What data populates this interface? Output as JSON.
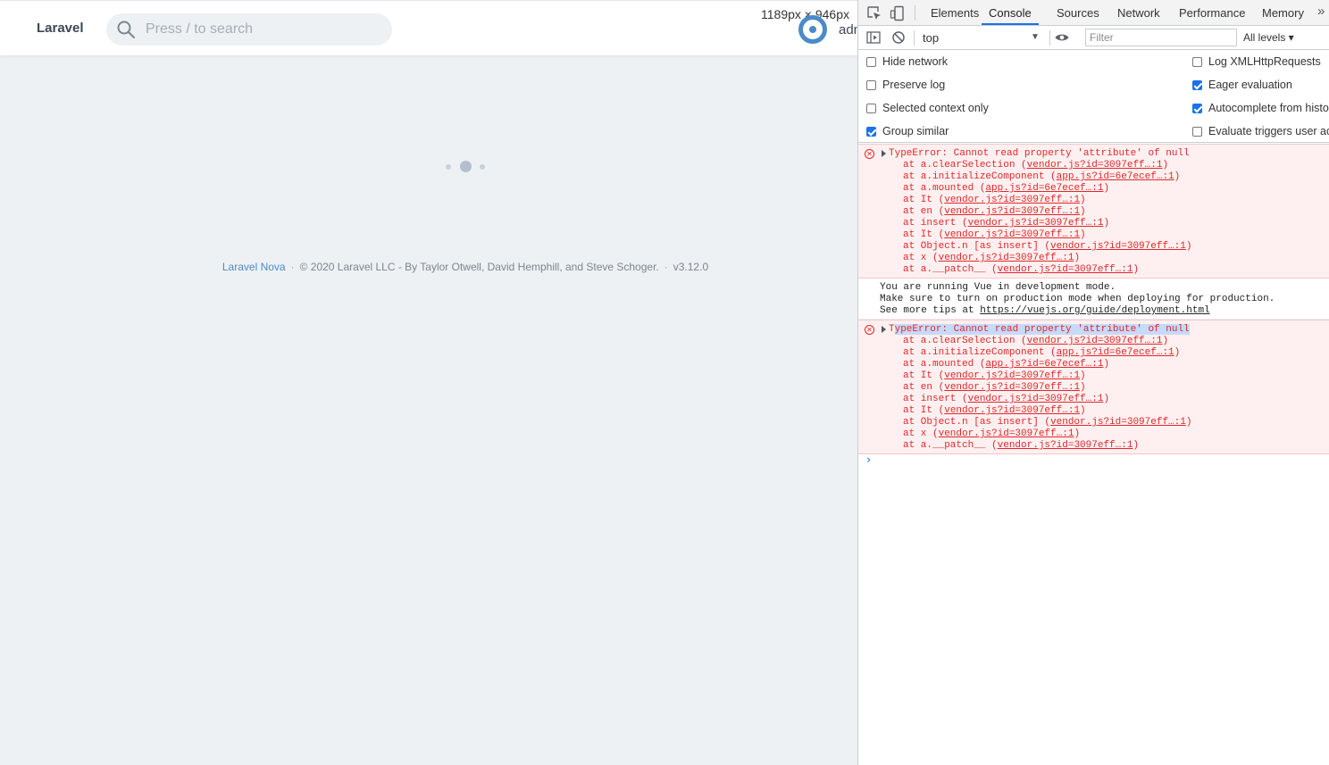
{
  "app": {
    "brand": "Laravel",
    "search_placeholder": "Press / to search",
    "dimensions_tip": "1189px × 946px",
    "user_name": "admin",
    "footer": {
      "link": "Laravel Nova",
      "copyright": "© 2020 Laravel LLC - By Taylor Otwell, David Hemphill, and Steve Schoger.",
      "version": "v3.12.0"
    }
  },
  "devtools": {
    "tabs": [
      "Elements",
      "Console",
      "Sources",
      "Network",
      "Performance",
      "Memory"
    ],
    "active_tab": "Console",
    "more": "»",
    "context": "top",
    "filter_placeholder": "Filter",
    "levels": "All levels ▾",
    "settings": {
      "hide_network": {
        "label": "Hide network",
        "checked": false
      },
      "preserve_log": {
        "label": "Preserve log",
        "checked": false
      },
      "selected_context": {
        "label": "Selected context only",
        "checked": false
      },
      "group_similar": {
        "label": "Group similar",
        "checked": true
      },
      "log_xhr": {
        "label": "Log XMLHttpRequests",
        "checked": false
      },
      "eager_eval": {
        "label": "Eager evaluation",
        "checked": true
      },
      "autocomplete": {
        "label": "Autocomplete from history",
        "checked": true
      },
      "eval_triggers": {
        "label": "Evaluate triggers user activation",
        "checked": false
      }
    },
    "console": {
      "error_head": "TypeError: Cannot read property 'attribute' of null",
      "frames": [
        {
          "fn": "at a.clearSelection (",
          "src": "vendor.js?id=3097eff…:1",
          "close": ")"
        },
        {
          "fn": "at a.initializeComponent (",
          "src": "app.js?id=6e7ecef…:1",
          "close": ")"
        },
        {
          "fn": "at a.mounted (",
          "src": "app.js?id=6e7ecef…:1",
          "close": ")"
        },
        {
          "fn": "at It (",
          "src": "vendor.js?id=3097eff…:1",
          "close": ")"
        },
        {
          "fn": "at en (",
          "src": "vendor.js?id=3097eff…:1",
          "close": ")"
        },
        {
          "fn": "at insert (",
          "src": "vendor.js?id=3097eff…:1",
          "close": ")"
        },
        {
          "fn": "at It (",
          "src": "vendor.js?id=3097eff…:1",
          "close": ")"
        },
        {
          "fn": "at Object.n [as insert] (",
          "src": "vendor.js?id=3097eff…:1",
          "close": ")"
        },
        {
          "fn": "at x (",
          "src": "vendor.js?id=3097eff…:1",
          "close": ")"
        },
        {
          "fn": "at a.__patch__ (",
          "src": "vendor.js?id=3097eff…:1",
          "close": ")"
        }
      ],
      "vue_line1": "You are running Vue in development mode.",
      "vue_line2": "Make sure to turn on production mode when deploying for production.",
      "vue_line3_prefix": "See more tips at ",
      "vue_line3_link": "https://vuejs.org/guide/deployment.html",
      "prompt": "›"
    }
  },
  "colors": {
    "accent": "#1a73e8",
    "error": "#e0282b",
    "nova_blue": "#4a8bc9"
  }
}
